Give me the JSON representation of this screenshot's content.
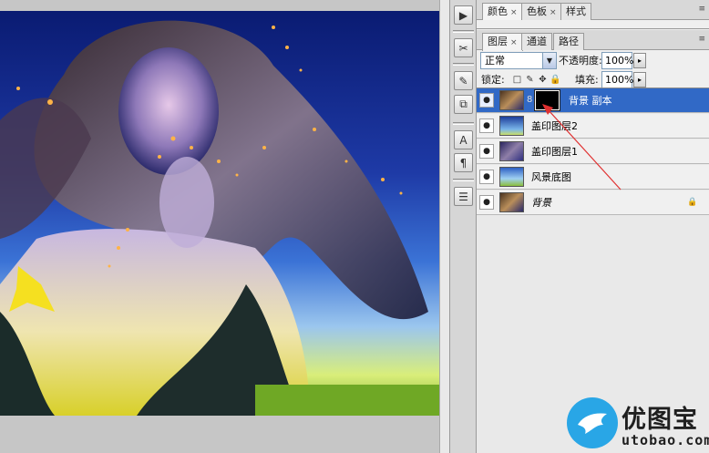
{
  "canvas": {
    "image_icon": "portrait-photo-with-sparkles"
  },
  "tool_strip": {
    "buttons": [
      {
        "icon": "play-icon",
        "glyph": "▶"
      },
      {
        "icon": "tools-icon",
        "glyph": "✂"
      },
      {
        "icon": "brush-preset-icon",
        "glyph": "✎"
      },
      {
        "icon": "clone-source-icon",
        "glyph": "⧉"
      },
      {
        "icon": "character-icon",
        "glyph": "A"
      },
      {
        "icon": "paragraph-icon",
        "glyph": "¶"
      },
      {
        "icon": "notes-icon",
        "glyph": "☰"
      }
    ]
  },
  "color_panel": {
    "tabs": [
      {
        "label": "颜色",
        "close": "×"
      },
      {
        "label": "色板",
        "close": "×"
      },
      {
        "label": "样式",
        "close": ""
      }
    ]
  },
  "layers_panel": {
    "tabs": [
      {
        "label": "图层",
        "close": "×"
      },
      {
        "label": "通道",
        "close": ""
      },
      {
        "label": "路径",
        "close": ""
      }
    ],
    "menu_glyph": "≡",
    "blend_mode": "正常",
    "opacity_label": "不透明度:",
    "opacity_value": "100%",
    "lock_label": "锁定:",
    "lock_icons": [
      "□",
      "✎",
      "✥",
      "🔒"
    ],
    "fill_label": "填充:",
    "fill_value": "100%",
    "spin_glyph": "▸",
    "eye_glyph": "●",
    "chain_glyph": "8",
    "lock_badge_glyph": "🔒",
    "layers": [
      {
        "name": "背景 副本",
        "thumb": "woman",
        "has_mask": true,
        "selected": true,
        "italic": false,
        "locked": false
      },
      {
        "name": "盖印图层2",
        "thumb": "blue",
        "has_mask": false,
        "selected": false,
        "italic": false,
        "locked": false
      },
      {
        "name": "盖印图层1",
        "thumb": "dark",
        "has_mask": false,
        "selected": false,
        "italic": false,
        "locked": false
      },
      {
        "name": "风景底图",
        "thumb": "land",
        "has_mask": false,
        "selected": false,
        "italic": false,
        "locked": false
      },
      {
        "name": "背景",
        "thumb": "woman",
        "has_mask": false,
        "selected": false,
        "italic": true,
        "locked": true
      }
    ]
  },
  "watermark": {
    "title": "优图宝",
    "url": "utobao.com",
    "accent": "#29a6e6"
  },
  "colors": {
    "selection": "#3169c6",
    "annotation_arrow": "#e03030"
  }
}
